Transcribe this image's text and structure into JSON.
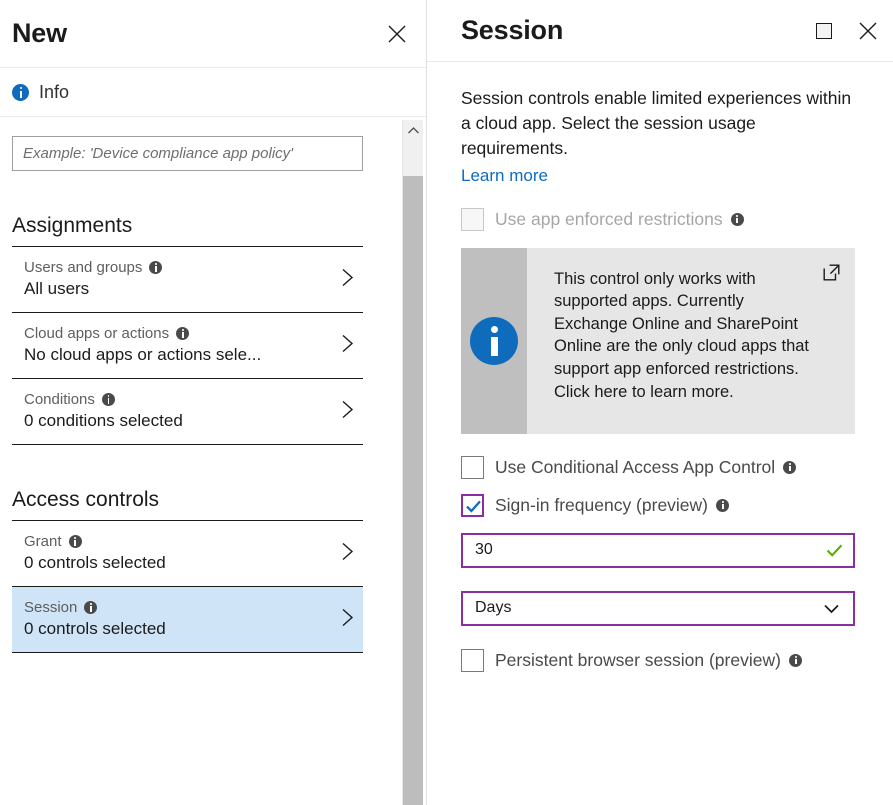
{
  "left_panel": {
    "title": "New",
    "close_icon": "close-icon",
    "info_bar": {
      "icon": "info-circle-icon",
      "label": "Info"
    },
    "name_field": {
      "value": "",
      "placeholder": "Example: 'Device compliance app policy'"
    },
    "sections": [
      {
        "heading": "Assignments",
        "rows": [
          {
            "label": "Users and groups",
            "value": "All users",
            "selected": false
          },
          {
            "label": "Cloud apps or actions",
            "value": "No cloud apps or actions sele...",
            "selected": false
          },
          {
            "label": "Conditions",
            "value": "0 conditions selected",
            "selected": false
          }
        ]
      },
      {
        "heading": "Access controls",
        "rows": [
          {
            "label": "Grant",
            "value": "0 controls selected",
            "selected": false
          },
          {
            "label": "Session",
            "value": "0 controls selected",
            "selected": true
          }
        ]
      }
    ],
    "scrollbar": {
      "up_arrow_icon": "chevron-up-icon"
    }
  },
  "right_panel": {
    "title": "Session",
    "maximize_icon": "maximize-icon",
    "close_icon": "close-icon",
    "description": "Session controls enable limited experiences within a cloud app. Select the session usage requirements.",
    "learn_more": "Learn more",
    "app_enforced": {
      "label": "Use app enforced restrictions",
      "checked": false,
      "disabled": true
    },
    "callout": {
      "icon": "info-circle-icon",
      "external_link_icon": "external-link-icon",
      "text": "This control only works with supported apps. Currently Exchange Online and SharePoint Online are the only cloud apps that support app enforced restrictions. Click here to learn more."
    },
    "cas_app_control": {
      "label": "Use Conditional Access App Control",
      "checked": false
    },
    "sign_in_frequency": {
      "label": "Sign-in frequency (preview)",
      "checked": true,
      "value": "30",
      "valid_icon": "checkmark-icon",
      "unit": "Days",
      "unit_chevron_icon": "chevron-down-icon"
    },
    "persistent_browser": {
      "label": "Persistent browser session (preview)",
      "checked": false
    }
  },
  "colors": {
    "accent_purple": "#8A2FA3",
    "link_blue": "#0F6CBD",
    "info_blue": "#0F6CBD",
    "valid_green": "#5CB200",
    "selected_row_blue": "#CFE4F7"
  }
}
